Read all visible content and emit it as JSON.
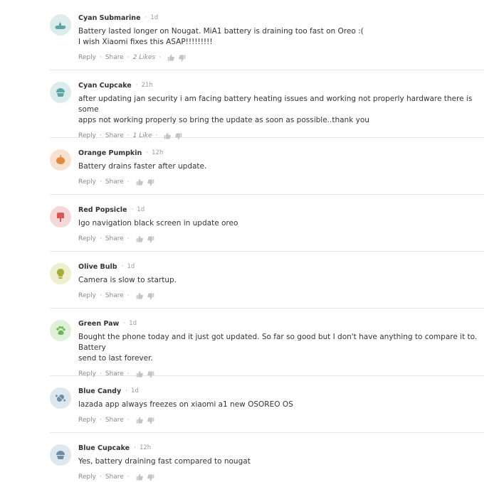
{
  "actions": {
    "reply": "Reply",
    "share": "Share"
  },
  "comments": [
    {
      "author": "Cyan Submarine",
      "time": "1d",
      "text": [
        "Battery lasted longer on Nougat. MiA1 battery is draining too fast on Oreo :(",
        "I wish Xiaomi fixes this ASAP!!!!!!!!!"
      ],
      "likes": "2 Likes",
      "avatar_color": "#dcecec",
      "icon_color": "#5aa6a6",
      "icon": "submarine-icon"
    },
    {
      "author": "Cyan Cupcake",
      "time": "21h",
      "text": [
        "after updating jan security i am facing battery heating issues and working not properly hardware there is some",
        "apps not working properly so bring the update as soon as possible..thank you"
      ],
      "likes": "1 Like",
      "avatar_color": "#dcecec",
      "icon_color": "#5aa6a6",
      "icon": "cupcake-icon"
    },
    {
      "author": "Orange Pumpkin",
      "time": "12h",
      "text": [
        "Battery drains faster after update."
      ],
      "likes": "",
      "avatar_color": "#f8e2cf",
      "icon_color": "#e08a3c",
      "icon": "pumpkin-icon"
    },
    {
      "author": "Red Popsicle",
      "time": "1d",
      "text": [
        "Igo navigation black screen in update oreo"
      ],
      "likes": "",
      "avatar_color": "#f6d7d7",
      "icon_color": "#d85757",
      "icon": "popsicle-icon"
    },
    {
      "author": "Olive Bulb",
      "time": "1d",
      "text": [
        "Camera is slow to startup."
      ],
      "likes": "",
      "avatar_color": "#edefcf",
      "icon_color": "#a8ad3a",
      "icon": "bulb-icon"
    },
    {
      "author": "Green Paw",
      "time": "1d",
      "text": [
        "Bought the phone today and it just got updated. So far so good but I don't have anything to compare it to. Battery",
        "send to last forever."
      ],
      "likes": "",
      "avatar_color": "#dff0d8",
      "icon_color": "#6db357",
      "icon": "paw-icon"
    },
    {
      "author": "Blue Candy",
      "time": "1d",
      "text": [
        "lazada app always freezes on xiaomi a1 new OSOREO OS"
      ],
      "likes": "",
      "avatar_color": "#dde7ef",
      "icon_color": "#6e8ea8",
      "icon": "candy-icon"
    },
    {
      "author": "Blue Cupcake",
      "time": "12h",
      "text": [
        "Yes, battery draining fast compared to nougat"
      ],
      "likes": "",
      "avatar_color": "#dde7ef",
      "icon_color": "#6e8ea8",
      "icon": "cupcake-icon"
    }
  ]
}
